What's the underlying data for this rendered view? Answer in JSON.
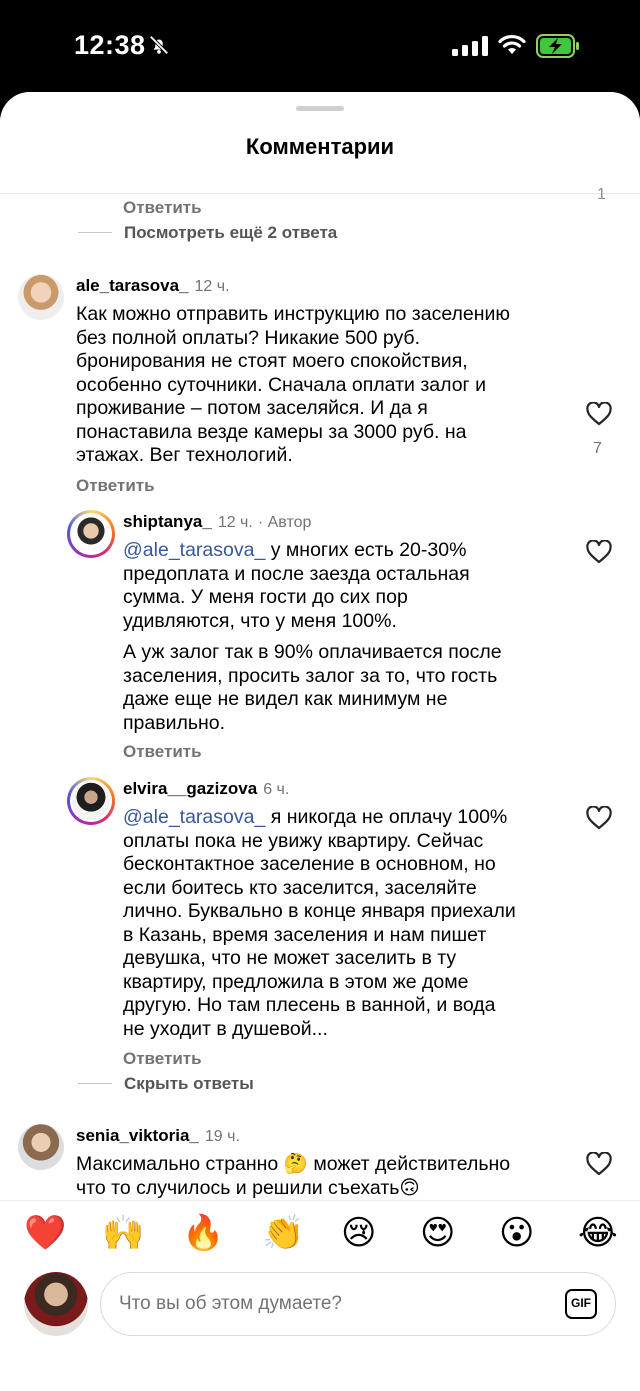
{
  "status_bar": {
    "time": "12:38"
  },
  "header": {
    "title": "Комментарии",
    "stray_mark": "1"
  },
  "top_thread": {
    "reply_label": "Ответить",
    "view_more": "Посмотреть ещё 2 ответа"
  },
  "comments": [
    {
      "username": "ale_tarasova_",
      "time": "12 ч.",
      "lines": [
        "Как можно отправить инструкцию по заселению",
        "без полной оплаты? Никакие 500 руб.",
        "бронирования не стоят моего спокойствия,",
        "особенно суточники. Сначала оплати залог и",
        "проживание – потом заселяйся. И да я",
        "понаставила везде камеры за 3000 руб. на",
        "этажах. Вег технологий."
      ],
      "likes": "7",
      "reply_label": "Ответить"
    },
    {
      "username": "shiptanya_",
      "time": "12 ч.",
      "author_tag": "· Автор",
      "mention": "@ale_tarasova_",
      "lines": [
        " у многих есть 20-30%",
        "предоплата и после заезда остальная",
        "сумма. У меня гости до сих пор",
        "удивляются, что у меня 100%."
      ],
      "lines2": [
        "А уж залог так в 90% оплачивается после",
        "заселения, просить  залог за то, что гость",
        "даже еще не видел как минимум не",
        "правильно."
      ],
      "reply_label": "Ответить"
    },
    {
      "username": "elvira__gazizova",
      "time": "6 ч.",
      "mention": "@ale_tarasova_",
      "lines": [
        " я никогда не оплачу 100%",
        "оплаты пока не увижу квартиру. Сейчас",
        "бесконтактное заселение в основном, но",
        "если боитесь кто заселится, заселяйте",
        "лично.  Буквально в конце января приехали",
        "в Казань, время заселения и нам пишет",
        "девушка, что не может заселить в ту",
        "квартиру, предложила в этом же доме",
        "другую. Но там плесень в ванной, и вода",
        "не уходит в душевой..."
      ],
      "reply_label": "Ответить",
      "hide_replies": "Скрыть ответы"
    },
    {
      "username": "senia_viktoria_",
      "time": "19 ч.",
      "lines": [
        "Максимально странно 🤔 может действительно",
        "что то случилось и решили съехать🙃"
      ]
    }
  ],
  "reactions": [
    "❤️",
    "🙌",
    "🔥",
    "👏",
    "😢",
    "😍",
    "😮",
    "😂"
  ],
  "composer": {
    "placeholder": "Что вы об этом думаете?",
    "gif_label": "GIF"
  }
}
